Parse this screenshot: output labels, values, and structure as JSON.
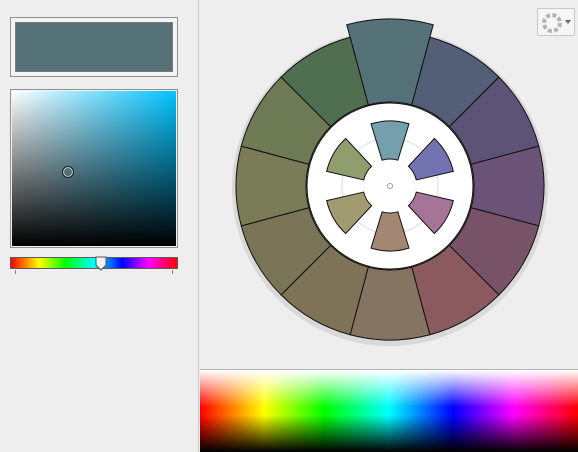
{
  "app": {
    "accent_color": "#537177",
    "icons": {
      "settings": "color-wheel-settings-icon",
      "dropdown": "chevron-down-icon"
    }
  },
  "picker": {
    "current_color": "#537177",
    "hue_fraction": 0.54,
    "saturation_fraction": 0.34,
    "brightness_fraction": 0.48
  },
  "wheel": {
    "rule": "hexad",
    "outer_segments": [
      "#537177",
      "#535e77",
      "#5d5377",
      "#6b5377",
      "#785368",
      "#8a5a5e",
      "#857462",
      "#7e7357",
      "#7a7457",
      "#7a7c57",
      "#6e7a54",
      "#4f6f50"
    ],
    "inner_swatches": [
      "#73a0aa",
      "#7273b0",
      "#a57496",
      "#a48773",
      "#a09b71",
      "#909e6f"
    ]
  }
}
